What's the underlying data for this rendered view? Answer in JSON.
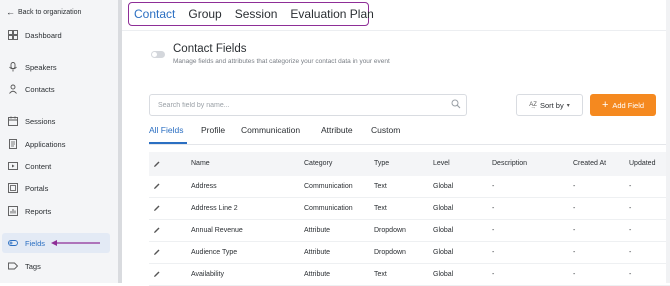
{
  "sidebar": {
    "back_label": "Back to organization",
    "items": [
      {
        "label": "Dashboard",
        "icon": "dashboard-icon"
      },
      {
        "label": "Speakers",
        "icon": "microphone-icon"
      },
      {
        "label": "Contacts",
        "icon": "person-icon"
      },
      {
        "label": "Sessions",
        "icon": "calendar-icon"
      },
      {
        "label": "Applications",
        "icon": "document-icon"
      },
      {
        "label": "Content",
        "icon": "video-icon"
      },
      {
        "label": "Portals",
        "icon": "portal-icon"
      },
      {
        "label": "Reports",
        "icon": "bar-chart-icon"
      },
      {
        "label": "Fields",
        "icon": "fields-icon",
        "active": true
      },
      {
        "label": "Tags",
        "icon": "tag-icon"
      }
    ]
  },
  "top_tabs": [
    "Contact",
    "Group",
    "Session",
    "Evaluation Plan"
  ],
  "active_top_tab": "Contact",
  "page": {
    "title": "Contact Fields",
    "subtitle": "Manage fields and attributes that categorize your contact data in your event"
  },
  "search": {
    "placeholder": "Search field by name...",
    "value": ""
  },
  "sort": {
    "label": "Sort by",
    "icon": "az-sort-icon"
  },
  "add_button": {
    "label": "Add Field"
  },
  "sub_tabs": [
    "All Fields",
    "Profile",
    "Communication",
    "Attribute",
    "Custom"
  ],
  "active_sub_tab": "All Fields",
  "table": {
    "columns": [
      "Name",
      "Category",
      "Type",
      "Level",
      "Description",
      "Created At",
      "Updated"
    ],
    "rows": [
      [
        "Address",
        "Communication",
        "Text",
        "Global",
        "-",
        "-",
        "-"
      ],
      [
        "Address Line 2",
        "Communication",
        "Text",
        "Global",
        "-",
        "-",
        "-"
      ],
      [
        "Annual Revenue",
        "Attribute",
        "Dropdown",
        "Global",
        "-",
        "-",
        "-"
      ],
      [
        "Audience Type",
        "Attribute",
        "Dropdown",
        "Global",
        "-",
        "-",
        "-"
      ],
      [
        "Availability",
        "Attribute",
        "Text",
        "Global",
        "-",
        "-",
        "-"
      ]
    ]
  },
  "colors": {
    "accent": "#2b6fc2",
    "primary_button": "#f5891f",
    "highlight_outline": "#8e2e97",
    "sidebar_bg": "#f4f5f7"
  }
}
